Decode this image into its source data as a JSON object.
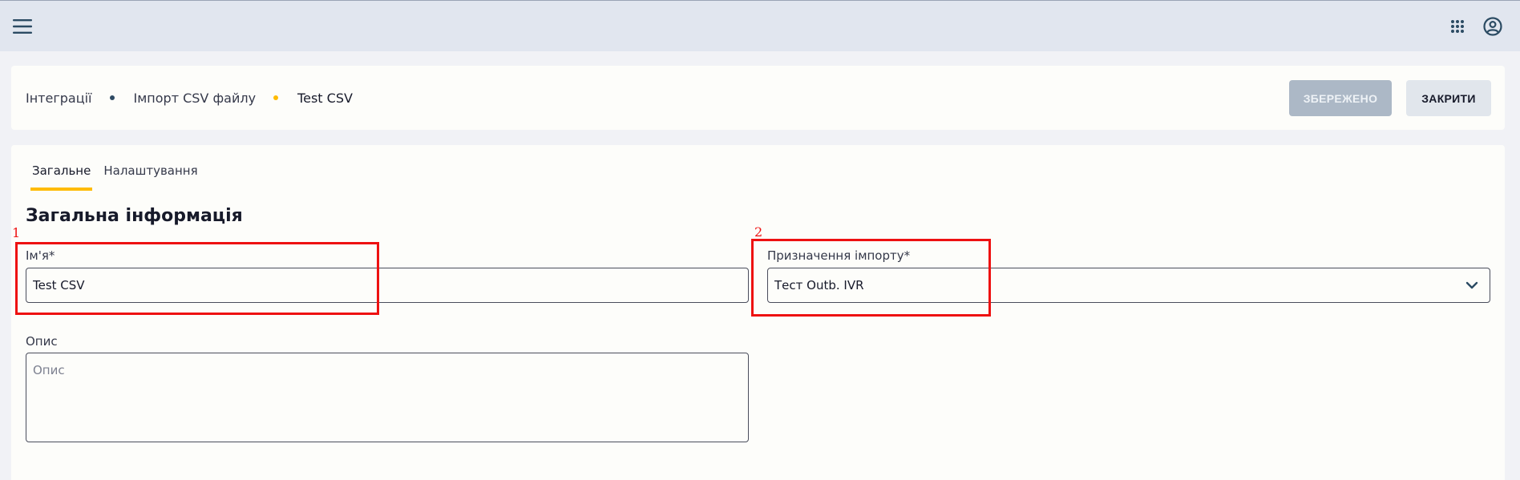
{
  "topbar": {
    "menu_icon": "hamburger-menu-icon",
    "apps_icon": "apps-grid-icon",
    "account_icon": "account-circle-icon"
  },
  "breadcrumb": {
    "items": [
      "Інтеграції",
      "Імпорт CSV файлу",
      "Test CSV"
    ]
  },
  "header_actions": {
    "saved_label": "ЗБЕРЕЖЕНО",
    "close_label": "ЗАКРИТИ"
  },
  "tabs": [
    {
      "label": "Загальне",
      "active": true
    },
    {
      "label": "Налаштування",
      "active": false
    }
  ],
  "section": {
    "title": "Загальна інформація"
  },
  "form": {
    "name": {
      "label": "Ім'я*",
      "value": "Test CSV"
    },
    "destination": {
      "label": "Призначення імпорту*",
      "value": "Тест Outb. IVR"
    },
    "description": {
      "label": "Опис",
      "placeholder": "Опис",
      "value": ""
    }
  },
  "annotations": [
    "1",
    "2"
  ],
  "colors": {
    "accent": "#ffbb00",
    "topbar_bg": "#e1e6ef",
    "page_bg": "#f1f2f6",
    "card_bg": "#fdfdfa",
    "saved_button_bg": "#acb8c6",
    "close_button_bg": "#e1e6ec",
    "annotation_red": "#ee1111"
  }
}
